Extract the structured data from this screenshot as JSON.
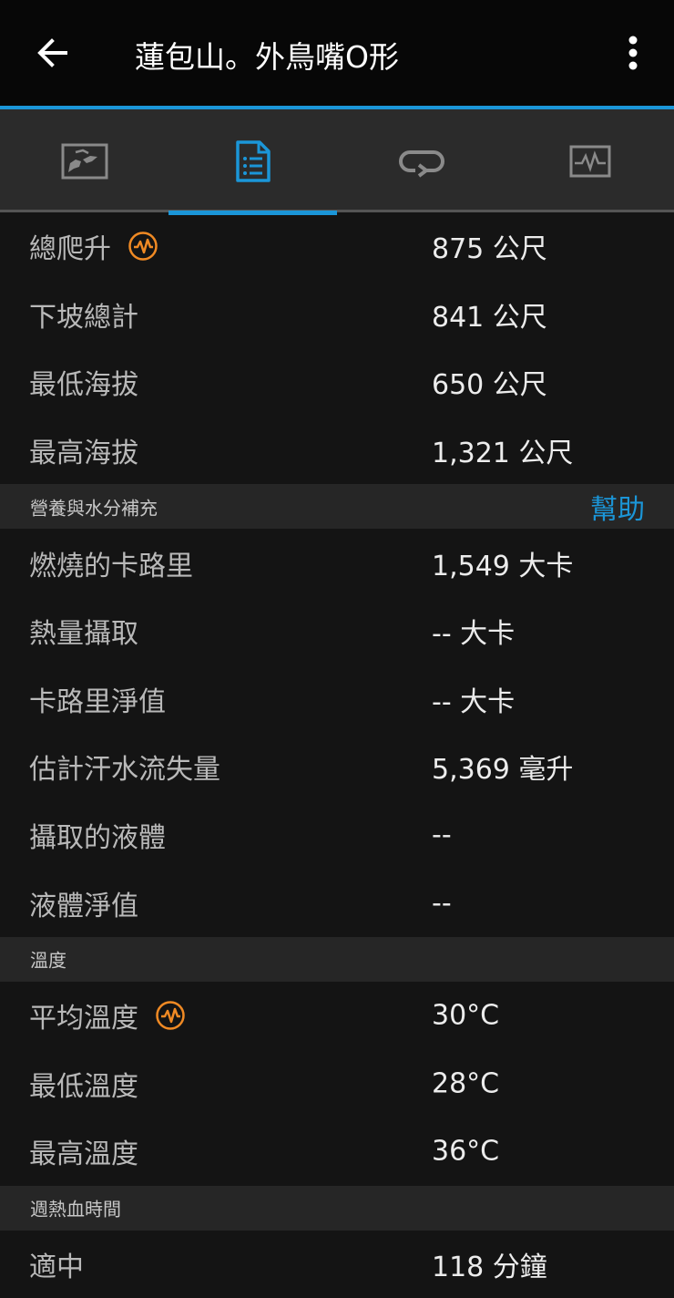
{
  "header": {
    "title": "蓮包山。外鳥嘴O形",
    "back_icon": "arrow-left-icon",
    "menu_icon": "more-vert-icon"
  },
  "tabs": [
    {
      "icon": "map-icon",
      "active": false
    },
    {
      "icon": "document-list-icon",
      "active": true
    },
    {
      "icon": "laps-repeat-icon",
      "active": false
    },
    {
      "icon": "chart-pulse-icon",
      "active": false
    }
  ],
  "colors": {
    "accent": "#1b96d8",
    "badge": "#f08a24",
    "background": "#141414",
    "section": "#262626"
  },
  "elevation": {
    "rows": [
      {
        "label": "總爬升",
        "value": "875 公尺",
        "badge": true
      },
      {
        "label": "下坡總計",
        "value": "841 公尺"
      },
      {
        "label": "最低海拔",
        "value": "650 公尺"
      },
      {
        "label": "最高海拔",
        "value": "1,321 公尺"
      }
    ]
  },
  "nutrition": {
    "title": "營養與水分補充",
    "help": "幫助",
    "rows": [
      {
        "label": "燃燒的卡路里",
        "value": "1,549 大卡"
      },
      {
        "label": "熱量攝取",
        "value": "-- 大卡"
      },
      {
        "label": "卡路里淨值",
        "value": "-- 大卡"
      },
      {
        "label": "估計汗水流失量",
        "value": "5,369 毫升"
      },
      {
        "label": "攝取的液體",
        "value": "--"
      },
      {
        "label": "液體淨值",
        "value": "--"
      }
    ]
  },
  "temperature": {
    "title": "溫度",
    "rows": [
      {
        "label": "平均溫度",
        "value": "30°C",
        "badge": true
      },
      {
        "label": "最低溫度",
        "value": "28°C"
      },
      {
        "label": "最高溫度",
        "value": "36°C"
      }
    ]
  },
  "intensity": {
    "title": "週熱血時間",
    "rows": [
      {
        "label": "適中",
        "value": "118 分鐘"
      }
    ]
  }
}
